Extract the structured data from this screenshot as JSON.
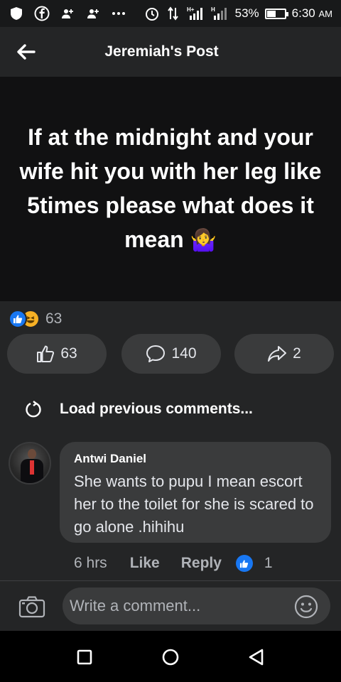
{
  "status_bar": {
    "battery_level": "53%",
    "battery_fraction": 0.53,
    "time": "6:30",
    "ampm": "AM",
    "network_label": "H+",
    "icons": [
      "shield-icon",
      "facebook-icon",
      "person-add-icon",
      "person-add-icon",
      "more-dots-icon",
      "alarm-icon",
      "data-transfer-icon",
      "signal-icon",
      "signal-icon",
      "battery-icon"
    ]
  },
  "header": {
    "title": "Jeremiah's Post",
    "back_icon": "arrow-left-icon"
  },
  "post": {
    "text": "If at the midnight and your wife hit you with her leg like 5times please what does it mean",
    "emoji": "🤷‍♀️"
  },
  "reactions": {
    "types": [
      "like",
      "haha"
    ],
    "count": "63"
  },
  "actions": {
    "like_count": "63",
    "comment_count": "140",
    "share_count": "2"
  },
  "load_previous": {
    "label": "Load previous comments..."
  },
  "comment": {
    "author": "Antwi Daniel",
    "text": "She wants to pupu I mean escort her to the toilet for she is scared to go alone .hihihu",
    "time": "6 hrs",
    "like_label": "Like",
    "reply_label": "Reply",
    "reaction_count": "1"
  },
  "composer": {
    "placeholder": "Write a comment..."
  },
  "colors": {
    "background": "#242526",
    "post_background": "#111112",
    "pill": "#3a3b3c",
    "accent": "#1877f2",
    "haha": "#f7b125"
  }
}
